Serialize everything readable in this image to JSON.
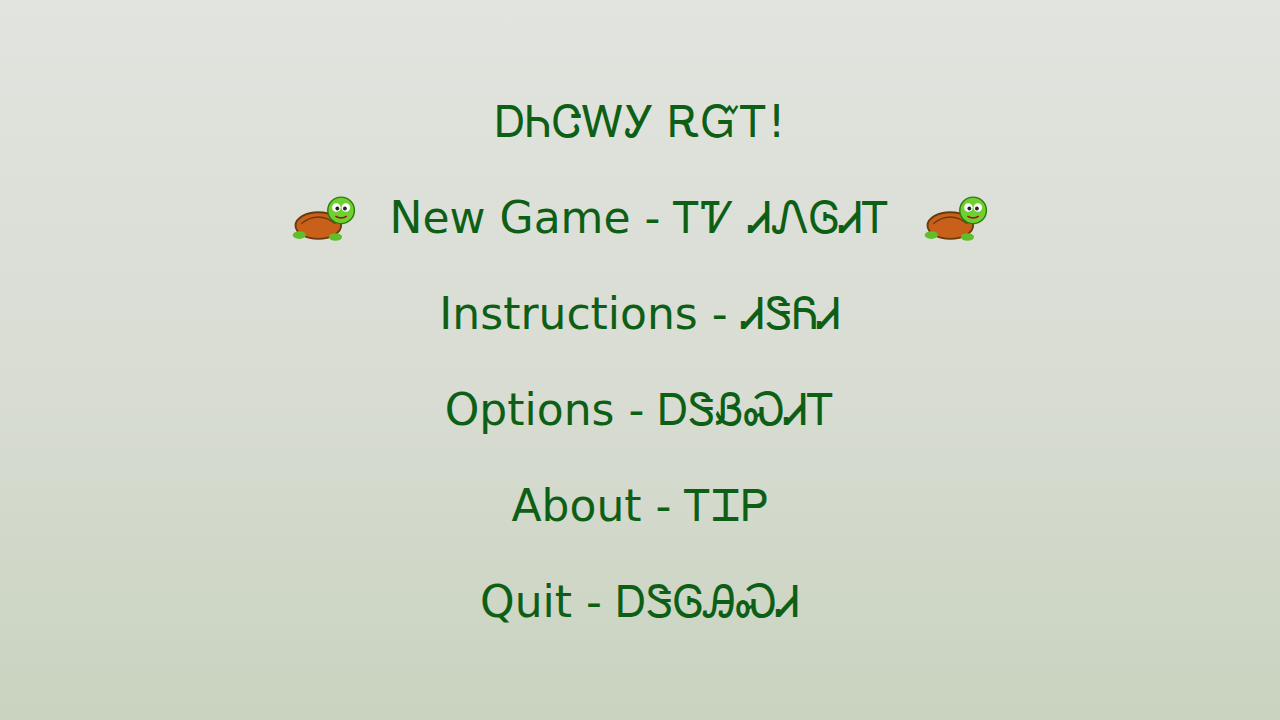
{
  "title": "ᎠᏂᏣᎳᎩ ᎡᏳᎢ!",
  "menu": [
    {
      "label": "New Game - ᎢᏤ ᏗᏁᎶᏗᎢ",
      "selected": true
    },
    {
      "label": "Instructions - ᏗᏕᏲᏗ",
      "selected": false
    },
    {
      "label": "Options - ᎠᏕᏰᏍᏗᎢ",
      "selected": false
    },
    {
      "label": "About - ᎢᏆᏢ",
      "selected": false
    },
    {
      "label": "Quit - ᎠᏕᎶᎯᏍᏗ",
      "selected": false
    }
  ]
}
